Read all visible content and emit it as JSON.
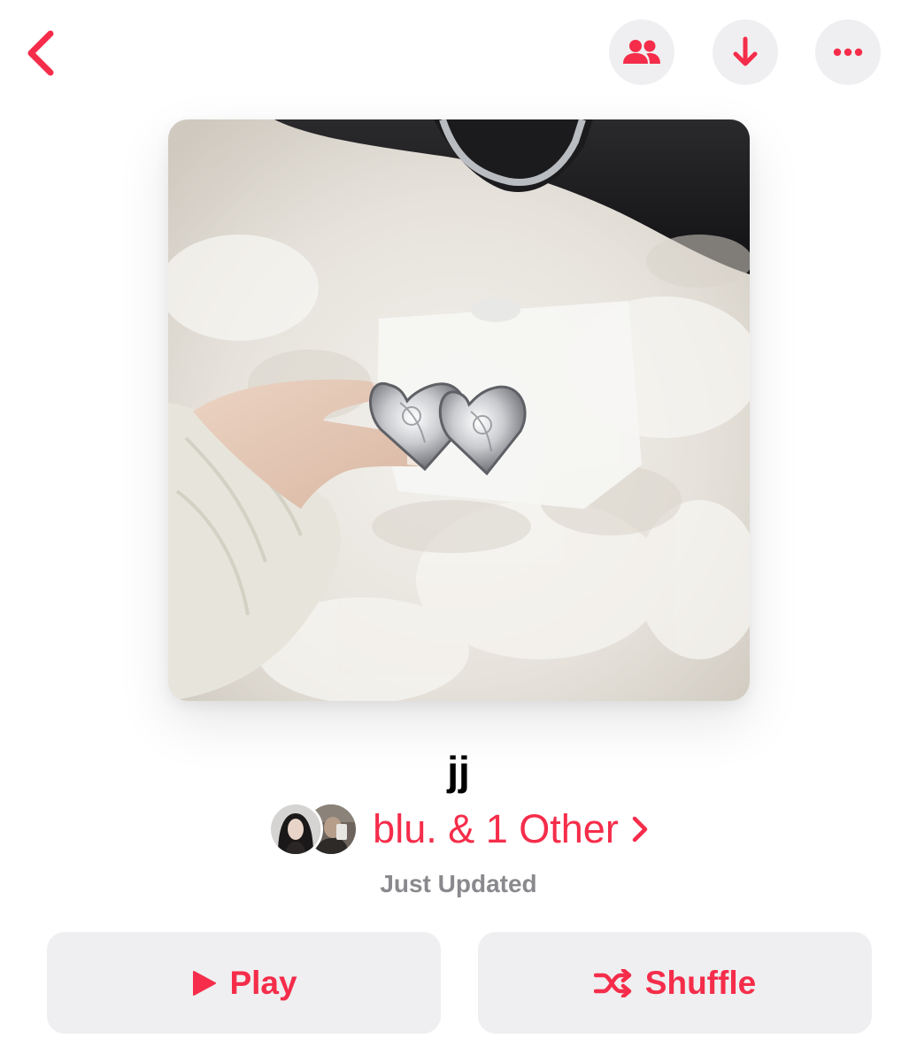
{
  "playlist": {
    "title": "jj",
    "curators_label": "blu. & 1 Other",
    "status": "Just Updated"
  },
  "actions": {
    "play_label": "Play",
    "shuffle_label": "Shuffle"
  },
  "icons": {
    "back": "chevron-left-icon",
    "collaborate": "people-icon",
    "download": "arrow-down-icon",
    "more": "ellipsis-icon",
    "play": "play-icon",
    "shuffle": "shuffle-icon",
    "curator_chevron": "chevron-right-icon"
  },
  "colors": {
    "accent": "#f52d4a",
    "button_bg": "#efeff1",
    "secondary_text": "#8a8a8e"
  }
}
